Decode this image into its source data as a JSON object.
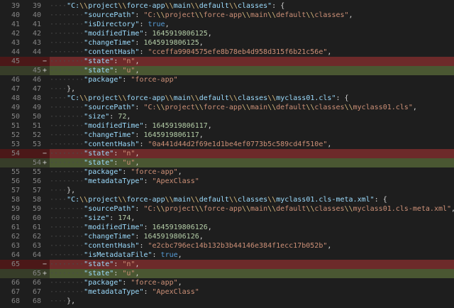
{
  "colors": {
    "editor_background": "#1e1e1e",
    "removed_line_background": "#4b1818",
    "removed_text_background": "#6d2a2a",
    "added_line_background": "#373d29",
    "added_text_background": "#4a5732",
    "line_number": "#858585",
    "key": "#9cdcfe",
    "string": "#ce9178",
    "number": "#b5cea8",
    "boolean": "#569cd6",
    "escape": "#d7ba7d",
    "punctuation": "#d4d4d4"
  },
  "diff_lines": [
    {
      "old": "39",
      "new": "39",
      "marker": "",
      "change": "none",
      "indent": 1,
      "code": "\"C:\\\\project\\\\force-app\\\\main\\\\default\\\\classes\": {"
    },
    {
      "old": "40",
      "new": "40",
      "marker": "",
      "change": "none",
      "indent": 2,
      "code": "\"sourcePath\": \"C:\\\\project\\\\force-app\\\\main\\\\default\\\\classes\","
    },
    {
      "old": "41",
      "new": "41",
      "marker": "",
      "change": "none",
      "indent": 2,
      "code": "\"isDirectory\": true,"
    },
    {
      "old": "42",
      "new": "42",
      "marker": "",
      "change": "none",
      "indent": 2,
      "code": "\"modifiedTime\": 1645919806125,"
    },
    {
      "old": "43",
      "new": "43",
      "marker": "",
      "change": "none",
      "indent": 2,
      "code": "\"changeTime\": 1645919806125,"
    },
    {
      "old": "44",
      "new": "44",
      "marker": "",
      "change": "none",
      "indent": 2,
      "code": "\"contentHash\": \"cceffa9904575efe8b78eb4d958d315f6b21c56e\","
    },
    {
      "old": "45",
      "new": "",
      "marker": "−",
      "change": "removed",
      "indent": 2,
      "code": "\"state\": \"n\","
    },
    {
      "old": "",
      "new": "45",
      "marker": "+",
      "change": "added",
      "indent": 2,
      "code": "\"state\": \"u\","
    },
    {
      "old": "46",
      "new": "46",
      "marker": "",
      "change": "none",
      "indent": 2,
      "code": "\"package\": \"force-app\""
    },
    {
      "old": "47",
      "new": "47",
      "marker": "",
      "change": "none",
      "indent": 1,
      "code": "},"
    },
    {
      "old": "48",
      "new": "48",
      "marker": "",
      "change": "none",
      "indent": 1,
      "code": "\"C:\\\\project\\\\force-app\\\\main\\\\default\\\\classes\\\\myclass01.cls\": {"
    },
    {
      "old": "49",
      "new": "49",
      "marker": "",
      "change": "none",
      "indent": 2,
      "code": "\"sourcePath\": \"C:\\\\project\\\\force-app\\\\main\\\\default\\\\classes\\\\myclass01.cls\","
    },
    {
      "old": "50",
      "new": "50",
      "marker": "",
      "change": "none",
      "indent": 2,
      "code": "\"size\": 72,"
    },
    {
      "old": "51",
      "new": "51",
      "marker": "",
      "change": "none",
      "indent": 2,
      "code": "\"modifiedTime\": 1645919806117,"
    },
    {
      "old": "52",
      "new": "52",
      "marker": "",
      "change": "none",
      "indent": 2,
      "code": "\"changeTime\": 1645919806117,"
    },
    {
      "old": "53",
      "new": "53",
      "marker": "",
      "change": "none",
      "indent": 2,
      "code": "\"contentHash\": \"0a441d44d2f69e1d1be4ef0773b5c589cd4f510e\","
    },
    {
      "old": "54",
      "new": "",
      "marker": "−",
      "change": "removed",
      "indent": 2,
      "code": "\"state\": \"n\","
    },
    {
      "old": "",
      "new": "54",
      "marker": "+",
      "change": "added",
      "indent": 2,
      "code": "\"state\": \"u\","
    },
    {
      "old": "55",
      "new": "55",
      "marker": "",
      "change": "none",
      "indent": 2,
      "code": "\"package\": \"force-app\","
    },
    {
      "old": "56",
      "new": "56",
      "marker": "",
      "change": "none",
      "indent": 2,
      "code": "\"metadataType\": \"ApexClass\""
    },
    {
      "old": "57",
      "new": "57",
      "marker": "",
      "change": "none",
      "indent": 1,
      "code": "},"
    },
    {
      "old": "58",
      "new": "58",
      "marker": "",
      "change": "none",
      "indent": 1,
      "code": "\"C:\\\\project\\\\force-app\\\\main\\\\default\\\\classes\\\\myclass01.cls-meta.xml\": {"
    },
    {
      "old": "59",
      "new": "59",
      "marker": "",
      "change": "none",
      "indent": 2,
      "code": "\"sourcePath\": \"C:\\\\project\\\\force-app\\\\main\\\\default\\\\classes\\\\myclass01.cls-meta.xml\","
    },
    {
      "old": "60",
      "new": "60",
      "marker": "",
      "change": "none",
      "indent": 2,
      "code": "\"size\": 174,"
    },
    {
      "old": "61",
      "new": "61",
      "marker": "",
      "change": "none",
      "indent": 2,
      "code": "\"modifiedTime\": 1645919806126,"
    },
    {
      "old": "62",
      "new": "62",
      "marker": "",
      "change": "none",
      "indent": 2,
      "code": "\"changeTime\": 1645919806126,"
    },
    {
      "old": "63",
      "new": "63",
      "marker": "",
      "change": "none",
      "indent": 2,
      "code": "\"contentHash\": \"e2cbc796ec14b132b3b44146e384f1ecc17b052b\","
    },
    {
      "old": "64",
      "new": "64",
      "marker": "",
      "change": "none",
      "indent": 2,
      "code": "\"isMetadataFile\": true,"
    },
    {
      "old": "65",
      "new": "",
      "marker": "−",
      "change": "removed",
      "indent": 2,
      "code": "\"state\": \"n\","
    },
    {
      "old": "",
      "new": "65",
      "marker": "+",
      "change": "added",
      "indent": 2,
      "code": "\"state\": \"u\","
    },
    {
      "old": "66",
      "new": "66",
      "marker": "",
      "change": "none",
      "indent": 2,
      "code": "\"package\": \"force-app\","
    },
    {
      "old": "67",
      "new": "67",
      "marker": "",
      "change": "none",
      "indent": 2,
      "code": "\"metadataType\": \"ApexClass\""
    },
    {
      "old": "68",
      "new": "68",
      "marker": "",
      "change": "none",
      "indent": 1,
      "code": "},"
    }
  ]
}
